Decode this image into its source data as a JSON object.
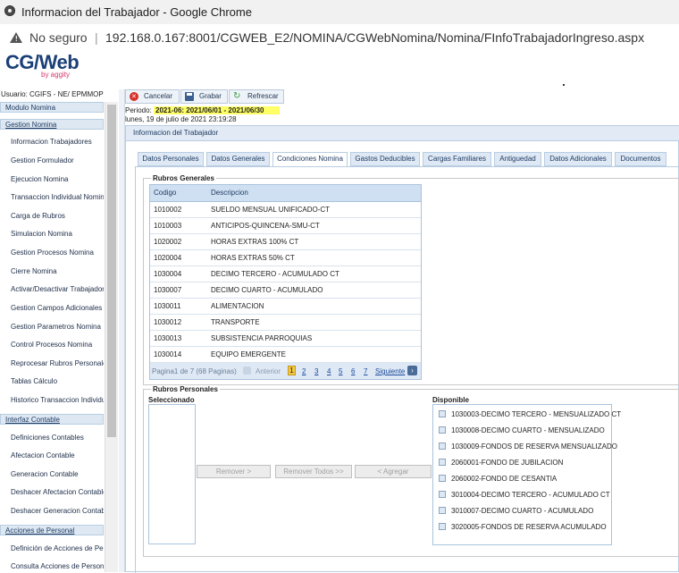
{
  "browser": {
    "window_title": "Informacion del Trabajador - Google Chrome",
    "security_label": "No seguro",
    "url": "192.168.0.167:8001/CGWEB_E2/NOMINA/CGWebNomina/Nomina/FInfoTrabajadorIngreso.aspx"
  },
  "brand": {
    "logo": "CG/Web",
    "logo_sub": "by aggity"
  },
  "sidebar": {
    "user": "Usuario: CGIFS - NE/ EPMMOP",
    "module_title": "Modulo Nomina",
    "sections": [
      {
        "title": "Gestion Nomina",
        "items": [
          "Informacion Trabajadores",
          "Gestion Formulador",
          "Ejecucion Nomina",
          "Transaccion Individual Nomina",
          "Carga de Rubros",
          "Simulacion Nomina",
          "Gestion Procesos Nomina",
          "Cierre Nomina",
          "Activar/Desactivar Trabajador",
          "Gestion Campos Adicionales",
          "Gestion Parametros Nomina",
          "Control Procesos Nomina",
          "Reprocesar Rubros Personales",
          "Tablas Cálculo",
          "Historico Transaccion Individual"
        ]
      },
      {
        "title": "Interfaz Contable",
        "items": [
          "Definiciones Contables",
          "Afectacion Contable",
          "Generacion Contable",
          "Deshacer Afectacion Contable",
          "Deshacer Generacion Contable"
        ]
      },
      {
        "title": "Acciones de Personal",
        "items": [
          "Definición de Acciones de Personal",
          "Consulta Acciones de Personal"
        ]
      }
    ]
  },
  "toolbar": {
    "cancel": "Cancelar",
    "save": "Grabar",
    "refresh": "Refrescar"
  },
  "period": {
    "label": "Periodo:",
    "value": "2021-06: 2021/06/01 - 2021/06/30"
  },
  "date_text": "lunes, 19 de julio de 2021 23:19:28",
  "panel_title": "Informacion del Trabajador",
  "tabs": [
    "Datos Personales",
    "Datos Generales",
    "Condiciones Nomina",
    "Gastos Deducibles",
    "Cargas Familiares",
    "Antiguedad",
    "Datos Adicionales",
    "Documentos"
  ],
  "active_tab": "Condiciones Nomina",
  "rubros_generales": {
    "legend": "Rubros Generales",
    "columns": [
      "Codigo",
      "Descripcion"
    ],
    "rows": [
      [
        "1010002",
        "SUELDO MENSUAL UNIFICADO-CT"
      ],
      [
        "1010003",
        "ANTICIPOS-QUINCENA-SMU-CT"
      ],
      [
        "1020002",
        "HORAS EXTRAS 100% CT"
      ],
      [
        "1020004",
        "HORAS EXTRAS 50% CT"
      ],
      [
        "1030004",
        "DECIMO TERCERO - ACUMULADO CT"
      ],
      [
        "1030007",
        "DECIMO CUARTO - ACUMULADO"
      ],
      [
        "1030011",
        "ALIMENTACION"
      ],
      [
        "1030012",
        "TRANSPORTE"
      ],
      [
        "1030013",
        "SUBSISTENCIA PARROQUIAS"
      ],
      [
        "1030014",
        "EQUIPO EMERGENTE"
      ]
    ],
    "pager": {
      "info": "Pagina1 de 7 (68 Paginas)",
      "prev": "Anterior",
      "pages": [
        "1",
        "2",
        "3",
        "4",
        "5",
        "6",
        "7"
      ],
      "current": "1",
      "next": "Siguiente"
    }
  },
  "rubros_personales": {
    "legend": "Rubros Personales",
    "selected_label": "Seleccionado",
    "available_label": "Disponible",
    "buttons": {
      "remove": "Remover >",
      "remove_all": "Remover Todos >>",
      "add": "< Agregar"
    },
    "available": [
      "1030003-DECIMO TERCERO - MENSUALIZADO CT",
      "1030008-DECIMO CUARTO - MENSUALIZADO",
      "1030009-FONDOS DE RESERVA MENSUALIZADO",
      "2060001-FONDO DE JUBILACION",
      "2060002-FONDO DE CESANTIA",
      "3010004-DECIMO TERCERO - ACUMULADO CT",
      "3010007-DECIMO CUARTO - ACUMULADO",
      "3020005-FONDOS DE RESERVA ACUMULADO"
    ]
  },
  "colors": {
    "accent": "#1f3a60",
    "period_highlight": "#ffff66",
    "logo": "#1a3f77"
  }
}
